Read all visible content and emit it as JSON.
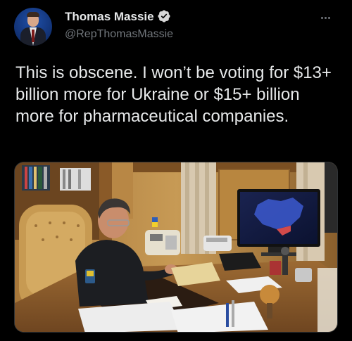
{
  "author": {
    "display_name": "Thomas Massie",
    "handle": "@RepThomasMassie",
    "verified": true
  },
  "tweet": {
    "text": "This is obscene. I won’t be voting for $13+ billion more for Ukraine or $15+ billion more for pharmaceutical companies."
  },
  "icons": {
    "verified": "verified-badge-icon",
    "more": "more-options-icon"
  },
  "colors": {
    "background": "#000000",
    "text_primary": "#e7e9ea",
    "text_secondary": "#71767b",
    "verified_badge": "#d9d9d9"
  },
  "media": {
    "alt": "Photo"
  }
}
